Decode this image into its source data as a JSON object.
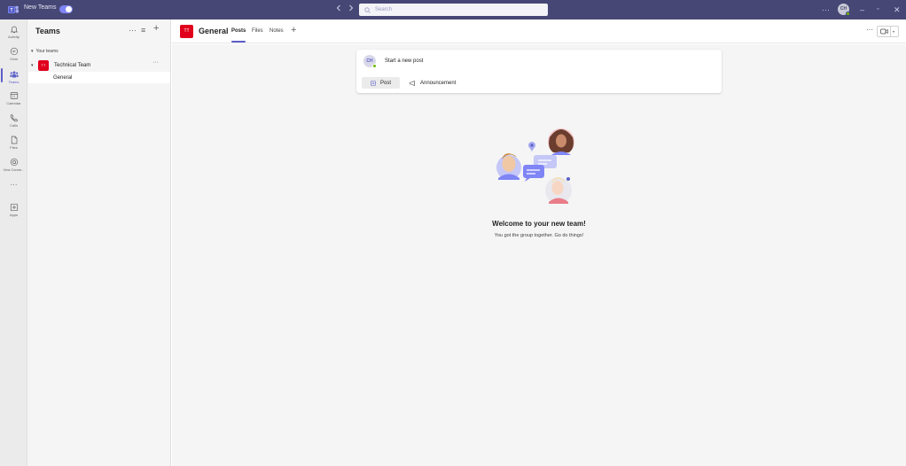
{
  "titlebar": {
    "app_title": "New Teams",
    "search_placeholder": "Search",
    "more": "···",
    "avatar_initials": "CH",
    "minimize": "–",
    "maximize": "▫",
    "close": "✕"
  },
  "rail": {
    "items": [
      {
        "label": "Activity",
        "icon": "bell-icon"
      },
      {
        "label": "Chat",
        "icon": "chat-icon"
      },
      {
        "label": "Teams",
        "icon": "teams-icon"
      },
      {
        "label": "Calendar",
        "icon": "calendar-icon"
      },
      {
        "label": "Calls",
        "icon": "phone-icon"
      },
      {
        "label": "Files",
        "icon": "file-icon"
      },
      {
        "label": "Viva Conne...",
        "icon": "viva-connections-icon"
      },
      {
        "label": "···",
        "icon": "more-icon"
      },
      {
        "label": "Apps",
        "icon": "apps-icon"
      }
    ],
    "active": "Teams"
  },
  "panel": {
    "title": "Teams",
    "more": "···",
    "filter": "≡",
    "add": "+",
    "your_teams": "Your teams",
    "team": {
      "badge": "TT",
      "name": "Technical Team",
      "more": "···"
    },
    "channel": "General"
  },
  "header": {
    "badge": "TT",
    "title": "General",
    "tabs": [
      "Posts",
      "Files",
      "Notes"
    ],
    "add_tab": "+",
    "more": "···"
  },
  "composer": {
    "avatar_initials": "CH",
    "placeholder": "Start a new post",
    "post_label": "Post",
    "announcement_label": "Announcement"
  },
  "empty_state": {
    "title": "Welcome to your new team!",
    "subtitle": "You got the group together. Go do things!"
  },
  "colors": {
    "titlebar": "#464775",
    "accent": "#5b5fc7",
    "team_badge": "#e0001b",
    "presence": "#6bb700"
  }
}
